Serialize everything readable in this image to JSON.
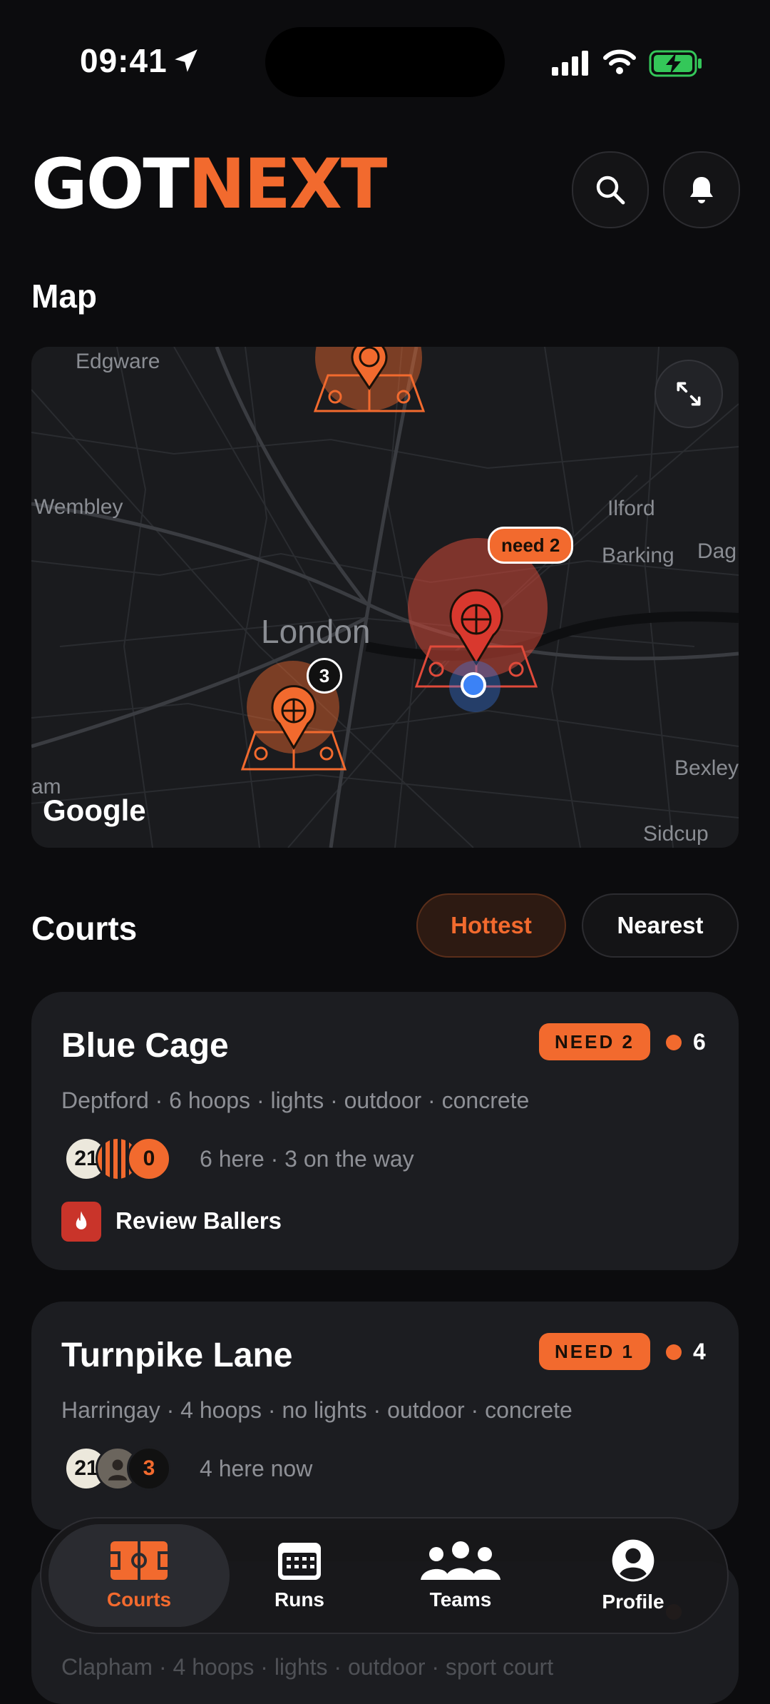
{
  "status_bar": {
    "time": "09:41"
  },
  "header": {
    "logo_part1": "GOT",
    "logo_part2": "NEXT"
  },
  "map_section": {
    "title": "Map",
    "labels": {
      "edgware": "Edgware",
      "wembley": "Wembley",
      "ilford": "Ilford",
      "barking": "Barking",
      "dag": "Dag",
      "london": "London",
      "bexley": "Bexley",
      "sidcup": "Sidcup",
      "am": "am",
      "google": "Google"
    },
    "cluster_count": "3",
    "need_callout": "need 2"
  },
  "courts_section": {
    "title": "Courts",
    "sort_options": {
      "hottest": "Hottest",
      "nearest": "Nearest"
    },
    "selected_sort": "Hottest"
  },
  "courts": [
    {
      "name": "Blue Cage",
      "need": "NEED 2",
      "hot_count": "6",
      "meta": "Deptford · 6 hoops · lights · outdoor · concrete",
      "avatars": [
        "21",
        "0"
      ],
      "presence": "6 here · 3 on the way",
      "tag": "Review Ballers"
    },
    {
      "name": "Turnpike Lane",
      "need": "NEED 1",
      "hot_count": "4",
      "meta": "Harringay · 4 hoops · no lights · outdoor · concrete",
      "avatars": [
        "21",
        "3"
      ],
      "presence": "4 here now"
    },
    {
      "meta": "Clapham · 4 hoops · lights · outdoor · sport court"
    }
  ],
  "nav": {
    "items": [
      {
        "label": "Courts",
        "icon": "court-icon",
        "active": true
      },
      {
        "label": "Runs",
        "icon": "calendar-icon"
      },
      {
        "label": "Teams",
        "icon": "people-icon"
      },
      {
        "label": "Profile",
        "icon": "person-icon"
      }
    ]
  },
  "colors": {
    "accent": "#f26a2e",
    "background": "#0c0c0e",
    "card": "#1c1d21",
    "user_location": "#3b82f6"
  }
}
